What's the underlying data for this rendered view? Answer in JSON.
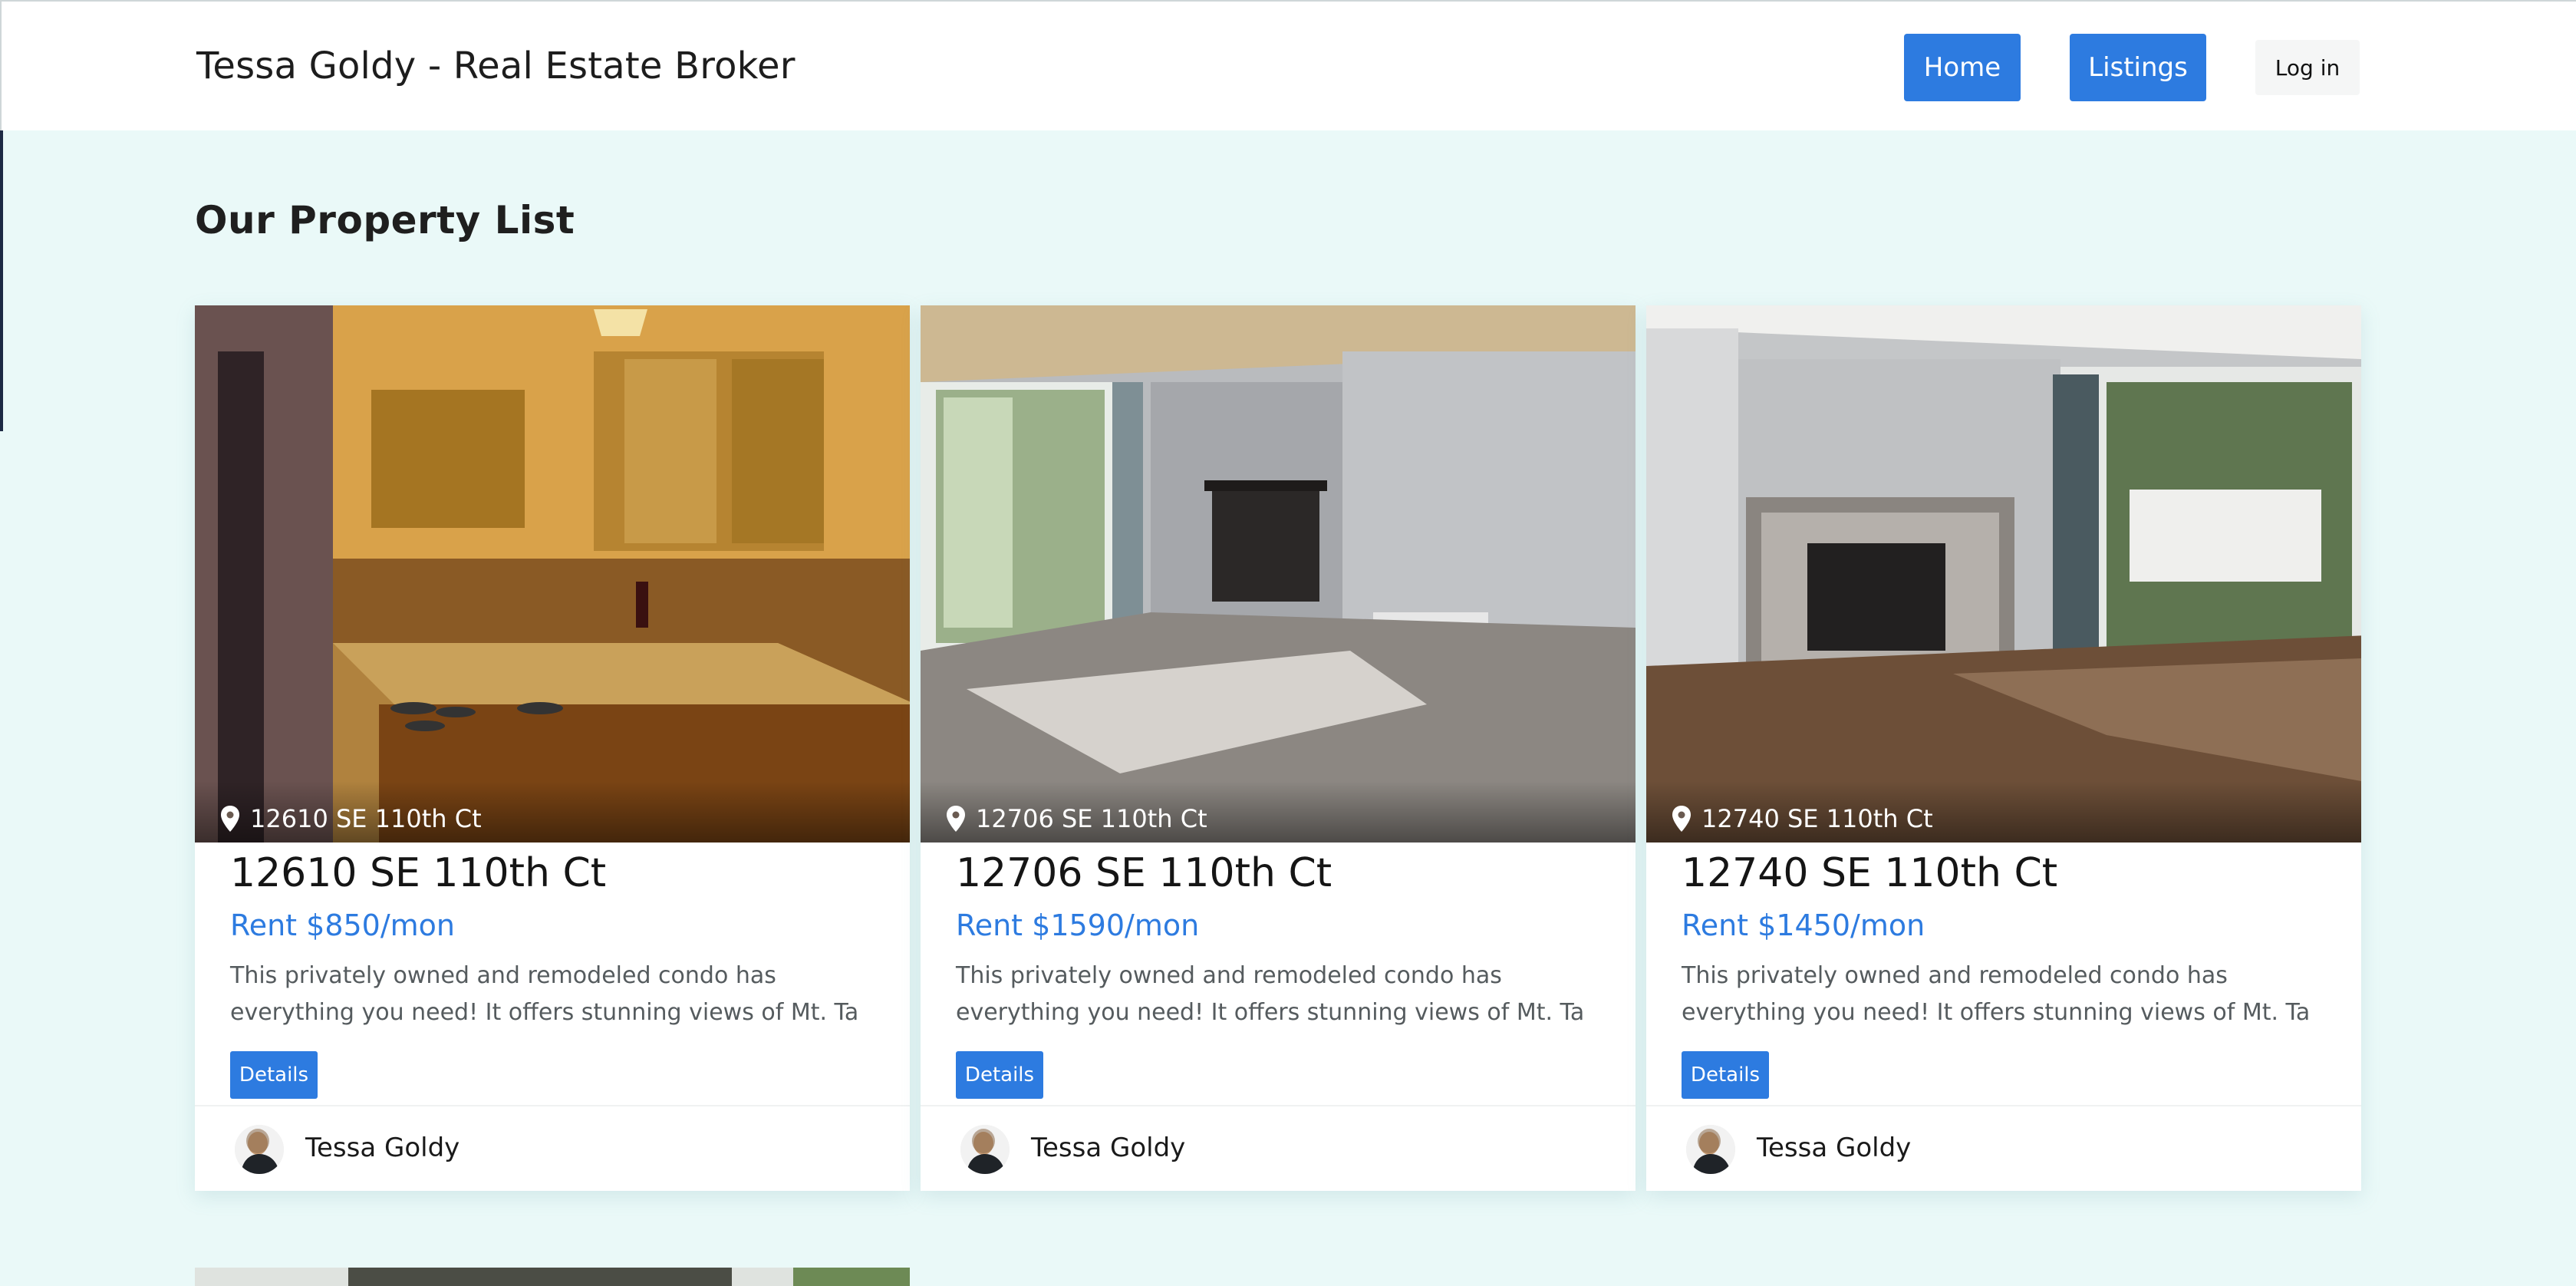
{
  "header": {
    "brand": "Tessa Goldy - Real Estate Broker",
    "nav": {
      "home": "Home",
      "listings": "Listings",
      "login": "Log in"
    }
  },
  "main": {
    "title": "Our Property List",
    "properties": [
      {
        "photo_address": "12610 SE 110th Ct",
        "title": "12610 SE 110th Ct",
        "price": "Rent $850/mon",
        "description": "This privately owned and remodeled condo has everything you need! It offers stunning views of Mt. Ta",
        "details_label": "Details",
        "agent": "Tessa Goldy",
        "photo_subject": "kitchen"
      },
      {
        "photo_address": "12706 SE 110th Ct",
        "title": "12706 SE 110th Ct",
        "price": "Rent $1590/mon",
        "description": "This privately owned and remodeled condo has everything you need! It offers stunning views of Mt. Ta",
        "details_label": "Details",
        "agent": "Tessa Goldy",
        "photo_subject": "living-room-carpet"
      },
      {
        "photo_address": "12740 SE 110th Ct",
        "title": "12740 SE 110th Ct",
        "price": "Rent $1450/mon",
        "description": "This privately owned and remodeled condo has everything you need! It offers stunning views of Mt. Ta",
        "details_label": "Details",
        "agent": "Tessa Goldy",
        "photo_subject": "living-room-wood-floor"
      }
    ]
  },
  "colors": {
    "accent": "#2d7be0",
    "page_background": "#eaf9f8"
  },
  "icons": {
    "pin": "map-pin-icon"
  }
}
